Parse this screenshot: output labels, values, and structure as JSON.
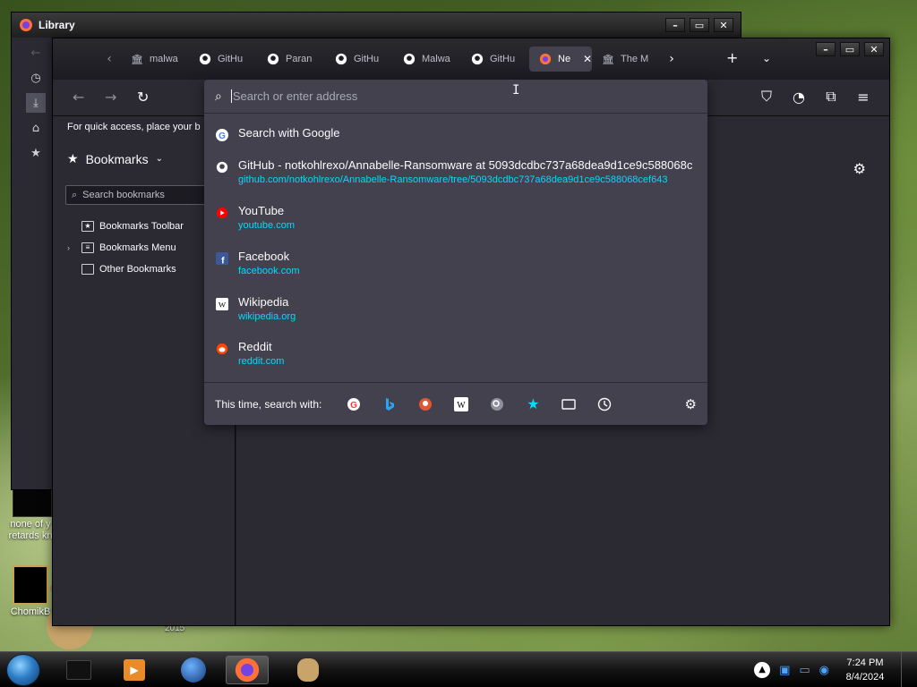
{
  "desktop": {
    "icons": [
      {
        "label": "none of y retards kn"
      },
      {
        "label": "ChomikB"
      }
    ],
    "year_label": "2015"
  },
  "library": {
    "title": "Library",
    "buttons": {
      "minimize": "–",
      "maximize": "▭",
      "close": "✕"
    }
  },
  "firefox": {
    "tabs": [
      {
        "label": "malwa",
        "icon": "museum-icon"
      },
      {
        "label": "GitHu",
        "icon": "github-icon"
      },
      {
        "label": "Paran",
        "icon": "github-icon"
      },
      {
        "label": "GitHu",
        "icon": "github-icon"
      },
      {
        "label": "Malwa",
        "icon": "github-icon"
      },
      {
        "label": "GitHu",
        "icon": "github-icon"
      },
      {
        "label": "Ne",
        "icon": "firefox-icon",
        "active": true
      },
      {
        "label": "The M",
        "icon": "museum-icon"
      }
    ],
    "bookmark_toolbar_message": "For quick access, place your b",
    "sidebar": {
      "title": "Bookmarks",
      "search_placeholder": "Search bookmarks",
      "tree": [
        {
          "label": "Bookmarks Toolbar",
          "icon": "star-folder-icon",
          "expandable": false
        },
        {
          "label": "Bookmarks Menu",
          "icon": "menu-folder-icon",
          "expandable": true
        },
        {
          "label": "Other Bookmarks",
          "icon": "folder-icon",
          "expandable": false
        }
      ]
    },
    "urlbar": {
      "placeholder": "Search or enter address",
      "suggestions": [
        {
          "title": "Search with Google",
          "url": "",
          "icon": "google-icon"
        },
        {
          "title": "GitHub - notkohlrexo/Annabelle-Ransomware at 5093dcdbc737a68dea9d1ce9c588068c",
          "url": "github.com/notkohlrexo/Annabelle-Ransomware/tree/5093dcdbc737a68dea9d1ce9c588068cef643",
          "icon": "github-icon"
        },
        {
          "title": "YouTube",
          "url": "youtube.com",
          "icon": "youtube-icon"
        },
        {
          "title": "Facebook",
          "url": "facebook.com",
          "icon": "facebook-icon"
        },
        {
          "title": "Wikipedia",
          "url": "wikipedia.org",
          "icon": "wikipedia-icon"
        },
        {
          "title": "Reddit",
          "url": "reddit.com",
          "icon": "reddit-icon"
        }
      ],
      "one_off_label": "This time, search with:",
      "one_off_engines": [
        "google-icon",
        "bing-icon",
        "duckduckgo-icon",
        "wikipedia-icon",
        "search-icon",
        "bookmarks-star-icon",
        "tabs-icon",
        "history-icon"
      ]
    }
  },
  "taskbar": {
    "time": "7:24 PM",
    "date": "8/4/2024"
  },
  "colors": {
    "accent_link": "#00ddff",
    "panel": "#42414d",
    "toolbar": "#2b2a33",
    "bg": "#1c1b22"
  }
}
